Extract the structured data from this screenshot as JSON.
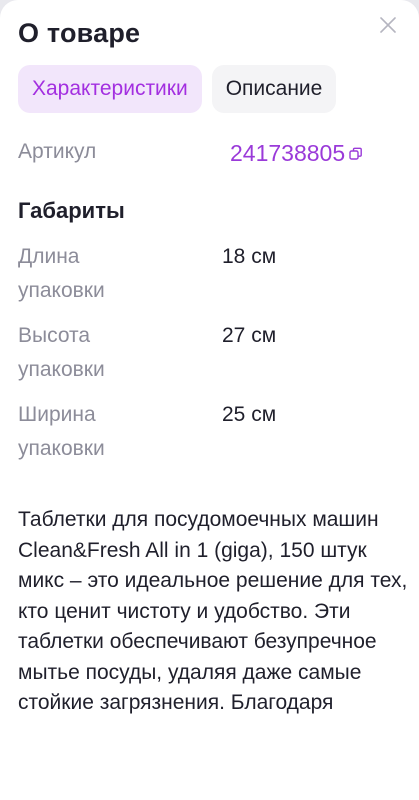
{
  "header": {
    "title": "О товаре"
  },
  "tabs": [
    {
      "label": "Характеристики",
      "active": true
    },
    {
      "label": "Описание",
      "active": false
    }
  ],
  "article": {
    "label": "Артикул",
    "value": "241738805"
  },
  "dimensions": {
    "title": "Габариты",
    "rows": [
      {
        "label_line1": "Длина",
        "label_line2": "упаковки",
        "value": "18 см"
      },
      {
        "label_line1": "Высота",
        "label_line2": "упаковки",
        "value": "27 см"
      },
      {
        "label_line1": "Ширина",
        "label_line2": "упаковки",
        "value": "25 см"
      }
    ]
  },
  "description": {
    "text": "Таблетки для посудомоечных машин Clean&Fresh All in 1 (giga), 150 штук микс – это идеальное решение для тех, кто ценит чистоту и удобство. Эти таблетки обеспечивают безупречное мытье посуды, удаляя даже самые стойкие загрязнения. Благодаря"
  },
  "colors": {
    "accent": "#a32fe0",
    "accent_bg": "#f2e6fb",
    "muted_text": "#8c8c99",
    "link": "#9a3ad9"
  },
  "icons": {
    "close": "close-icon",
    "copy": "copy-icon"
  }
}
